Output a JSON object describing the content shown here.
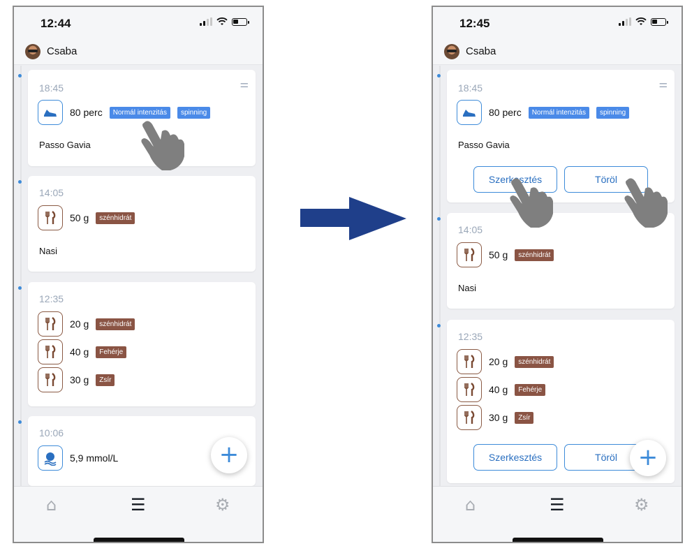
{
  "left": {
    "status": {
      "time": "12:44"
    },
    "user": {
      "name": "Csaba"
    },
    "cards": {
      "activity": {
        "time": "18:45",
        "amount": "80 perc",
        "tag1": "Normál intenzitás",
        "tag2": "spinning",
        "name": "Passo Gavia"
      },
      "meal1": {
        "time": "14:05",
        "amount": "50 g",
        "tag": "szénhidrát",
        "name": "Nasi"
      },
      "meal2": {
        "time": "12:35",
        "rows": [
          {
            "amount": "20 g",
            "tag": "szénhidrát"
          },
          {
            "amount": "40 g",
            "tag": "Fehérje"
          },
          {
            "amount": "30 g",
            "tag": "Zsír"
          }
        ]
      },
      "glucose": {
        "time": "10:06",
        "value": "5,9 mmol/L"
      }
    }
  },
  "right": {
    "status": {
      "time": "12:45"
    },
    "user": {
      "name": "Csaba"
    },
    "cards": {
      "activity": {
        "time": "18:45",
        "amount": "80 perc",
        "tag1": "Normál intenzitás",
        "tag2": "spinning",
        "name": "Passo Gavia",
        "edit_label": "Szerkesztés",
        "delete_label": "Töröl"
      },
      "meal1": {
        "time": "14:05",
        "amount": "50 g",
        "tag": "szénhidrát",
        "name": "Nasi"
      },
      "meal2": {
        "time": "12:35",
        "rows": [
          {
            "amount": "20 g",
            "tag": "szénhidrát"
          },
          {
            "amount": "40 g",
            "tag": "Fehérje"
          },
          {
            "amount": "30 g",
            "tag": "Zsír"
          }
        ],
        "edit_label": "Szerkesztés",
        "delete_label": "Töröl"
      }
    }
  },
  "icons": {
    "add": "+",
    "filter": "⚌",
    "home": "⌂",
    "list": "☰",
    "settings": "⚙",
    "meal": "🍴",
    "shoe": "👟",
    "drop": "💧"
  },
  "colors": {
    "accent": "#3d8bd9",
    "tag_blue": "#4a8ae8",
    "tag_brown": "#8a5444",
    "arrow": "#1f3f8a"
  }
}
